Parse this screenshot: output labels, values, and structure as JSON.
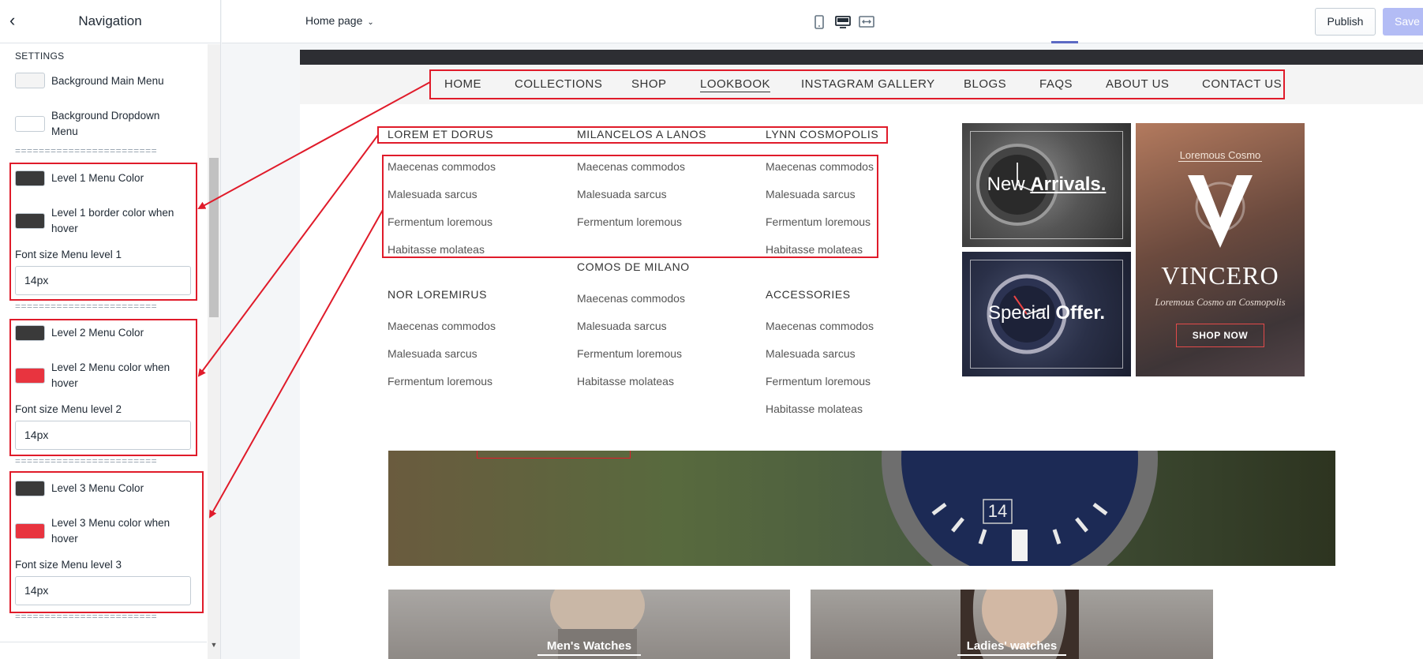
{
  "sidebar": {
    "title": "Navigation",
    "section_label": "SETTINGS",
    "bg_main_label": "Background Main Menu",
    "bg_dropdown_label": "Background Dropdown Menu",
    "divider": "========================",
    "level1": {
      "color_label": "Level 1 Menu Color",
      "hover_label": "Level 1 border color when hover",
      "font_label": "Font size Menu level 1",
      "font_value": "14px",
      "color": "#3a3a3a",
      "hover_color": "#3a3a3a"
    },
    "level2": {
      "color_label": "Level 2 Menu Color",
      "hover_label": "Level 2 Menu color when hover",
      "font_label": "Font size Menu level 2",
      "font_value": "14px",
      "color": "#3a3a3a",
      "hover_color": "#e8343f"
    },
    "level3": {
      "color_label": "Level 3 Menu Color",
      "hover_label": "Level 3 Menu color when hover",
      "font_label": "Font size Menu level 3",
      "font_value": "14px",
      "color": "#3a3a3a",
      "hover_color": "#e8343f"
    }
  },
  "topbar": {
    "page_select": "Home page",
    "publish": "Publish",
    "save": "Save"
  },
  "store": {
    "nav": [
      "HOME",
      "COLLECTIONS",
      "SHOP",
      "LOOKBOOK",
      "INSTAGRAM GALLERY",
      "BLOGS",
      "FAQS",
      "ABOUT US",
      "CONTACT US"
    ],
    "menu": {
      "col1_head": "LOREM ET DORUS",
      "col2_head": "MILANCELOS A LANOS",
      "col3_head": "LYNN COSMOPOLIS",
      "col1_links": [
        "Maecenas commodos",
        "Malesuada sarcus",
        "Fermentum loremous",
        "Habitasse molateas"
      ],
      "col2_links": [
        "Maecenas commodos",
        "Malesuada sarcus",
        "Fermentum loremous"
      ],
      "col3_links": [
        "Maecenas commodos",
        "Malesuada sarcus",
        "Fermentum loremous",
        "Habitasse molateas"
      ],
      "col2_head_b": "COMOS DE MILANO",
      "col1_head_b": "NOR LOREMIRUS",
      "col3_head_b": "ACCESSORIES",
      "col1_links_b": [
        "Maecenas commodos",
        "Malesuada sarcus",
        "Fermentum loremous"
      ],
      "col2_links_b": [
        "Maecenas commodos",
        "Malesuada sarcus",
        "Fermentum loremous",
        "Habitasse molateas"
      ],
      "col3_links_b": [
        "Maecenas commodos",
        "Malesuada sarcus",
        "Fermentum loremous",
        "Habitasse molateas"
      ]
    },
    "promo": {
      "new_a": "New ",
      "new_b": "Arrivals.",
      "special_a": "Special ",
      "special_b": "Offer.",
      "cosmo_title": "Loremous Cosmo",
      "brand": "VINCERO",
      "tagline": "Loremous Cosmo an Cosmopolis",
      "cta": "SHOP NOW"
    },
    "categories": [
      "Men's Watches",
      "Ladies' watches"
    ]
  },
  "colors": {
    "accent": "#5c6ac4",
    "annotation_red": "#e01b2a"
  }
}
